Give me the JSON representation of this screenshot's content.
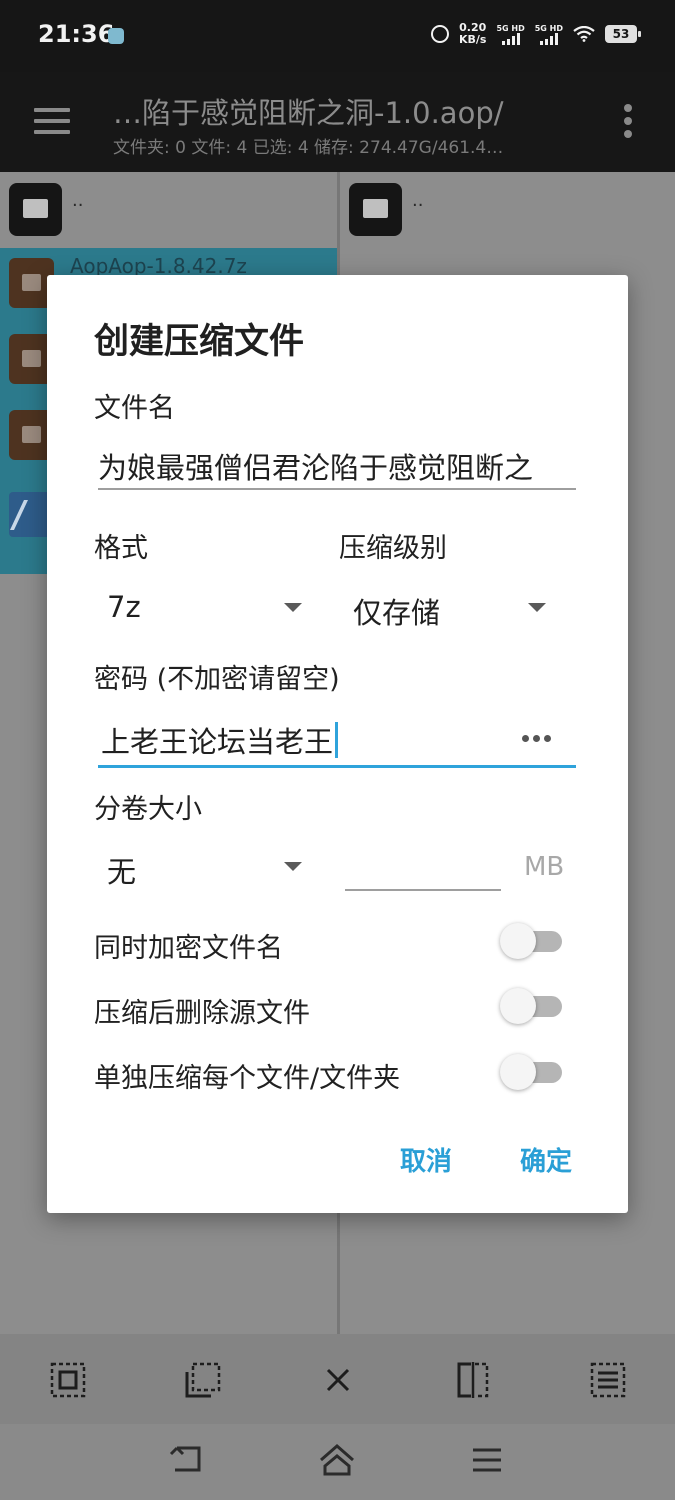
{
  "status_bar": {
    "time": "21:36",
    "net_speed_value": "0.20",
    "net_speed_unit": "KB/s",
    "sim1_label": "5G HD",
    "sim2_label": "5G HD",
    "battery": "53"
  },
  "app_bar": {
    "title": "…陷于感觉阻断之洞-1.0.aop/",
    "subtitle": "文件夹: 0  文件: 4  已选: 4  储存: 274.47G/461.4…"
  },
  "left_pane": {
    "parent": "..",
    "files": [
      {
        "name": "AopAop-1.8.42.7z",
        "icon": "archive-icon"
      },
      {
        "name": "",
        "icon": "archive-icon"
      },
      {
        "name": "",
        "icon": "archive-icon"
      },
      {
        "name": "",
        "icon": "apk-icon"
      }
    ]
  },
  "right_pane": {
    "parent": ".."
  },
  "dialog": {
    "title": "创建压缩文件",
    "filename_label": "文件名",
    "filename_value": "为娘最强僧侣君沦陷于感觉阻断之",
    "format_label": "格式",
    "format_value": "7z",
    "level_label": "压缩级别",
    "level_value": "仅存储",
    "password_label": "密码 (不加密请留空)",
    "password_value": "上老王论坛当老王",
    "volume_label": "分卷大小",
    "volume_value": "无",
    "volume_unit": "MB",
    "volume_size_value": "",
    "encrypt_names_label": "同时加密文件名",
    "delete_source_label": "压缩后删除源文件",
    "separate_label": "单独压缩每个文件/文件夹",
    "toggles": {
      "encrypt_names": false,
      "delete_source": false,
      "separate": false
    },
    "cancel_label": "取消",
    "ok_label": "确定"
  },
  "colors": {
    "accent": "#2fa3db",
    "scrim": "#8a8a8a",
    "selection": "#2c7a8c"
  }
}
